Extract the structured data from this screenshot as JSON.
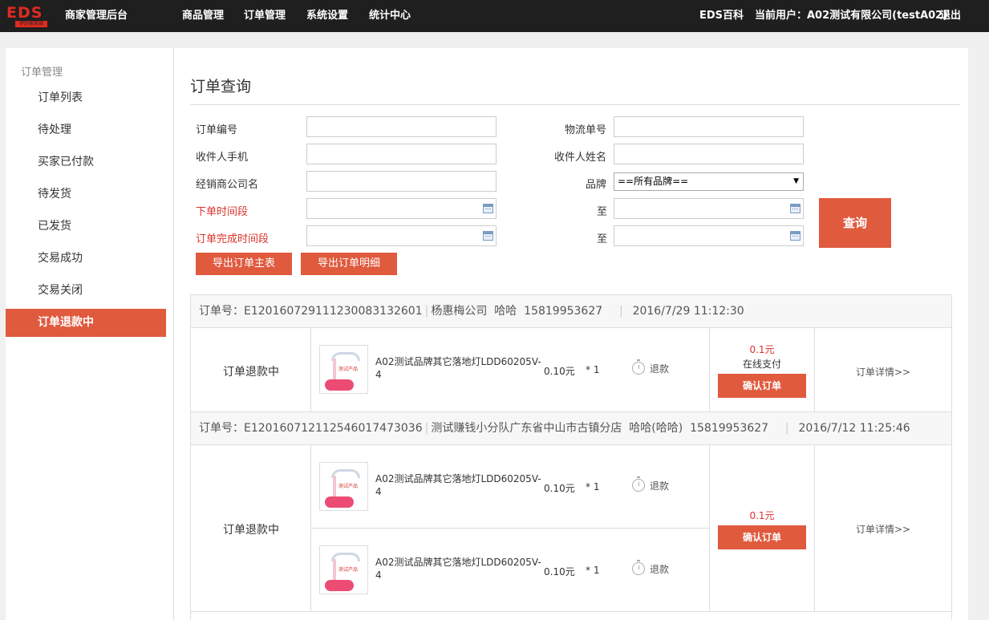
{
  "topbar": {
    "logo_text": "EDS",
    "logo_sub": "伊的家商城",
    "admin_title": "商家管理后台",
    "nav": [
      "商品管理",
      "订单管理",
      "系统设置",
      "统计中心"
    ],
    "wiki": "EDS百科",
    "current_user": "当前用户：A02测试有限公司(testA02)",
    "logout": "退出"
  },
  "sidebar": {
    "section_title": "订单管理",
    "items": [
      "订单列表",
      "待处理",
      "买家已付款",
      "待发货",
      "已发货",
      "交易成功",
      "交易关闭",
      "订单退款中"
    ],
    "active_index": 7
  },
  "main": {
    "page_title": "订单查询",
    "form": {
      "order_no_label": "订单编号",
      "logistics_no_label": "物流单号",
      "receiver_phone_label": "收件人手机",
      "receiver_name_label": "收件人姓名",
      "dealer_label": "经销商公司名",
      "brand_label": "品牌",
      "brand_value": "==所有品牌==",
      "order_time_label": "下单时间段",
      "complete_time_label": "订单完成时间段",
      "to_label": "至",
      "query_button": "查询",
      "export_main_button": "导出订单主表",
      "export_detail_button": "导出订单明细"
    },
    "orders": [
      {
        "header": {
          "order_no": "订单号：E12016072911123008313260​1",
          "dealer": "杨惠梅公司",
          "receiver": "哈哈",
          "phone": "15819953627",
          "time": "2016/7/29 11:12:30"
        },
        "status": "订单退款中",
        "products": [
          {
            "thumb_text": "测试产品",
            "name": "A02测试品牌其它落地灯LDD60205V-4",
            "price": "0.10元",
            "qty": "* 1",
            "refund": "退款"
          }
        ],
        "amount": "0.1元",
        "payment": "在线支付",
        "confirm_button": "确认订单",
        "detail_link": "订单详情>>"
      },
      {
        "header": {
          "order_no": "订单号：E120160712112546017473036",
          "dealer": "测试赚钱小分队广东省中山市古镇分店",
          "receiver": "哈哈(哈哈)",
          "phone": "15819953627",
          "time": "2016/7/12 11:25:46"
        },
        "status": "订单退款中",
        "products": [
          {
            "thumb_text": "测试产品",
            "name": "A02测试品牌其它落地灯LDD60205V-4",
            "price": "0.10元",
            "qty": "* 1",
            "refund": "退款"
          },
          {
            "thumb_text": "测试产品",
            "name": "A02测试品牌其它落地灯LDD60205V-4",
            "price": "0.10元",
            "qty": "* 1",
            "refund": "退款"
          }
        ],
        "amount": "0.1元",
        "payment": "",
        "confirm_button": "确认订单",
        "detail_link": "订单详情>>"
      }
    ]
  },
  "colors": {
    "accent": "#e05a3e",
    "topbar_bg": "#1f1f1f",
    "price_red": "#e0302a",
    "label_red": "#d9332a"
  }
}
